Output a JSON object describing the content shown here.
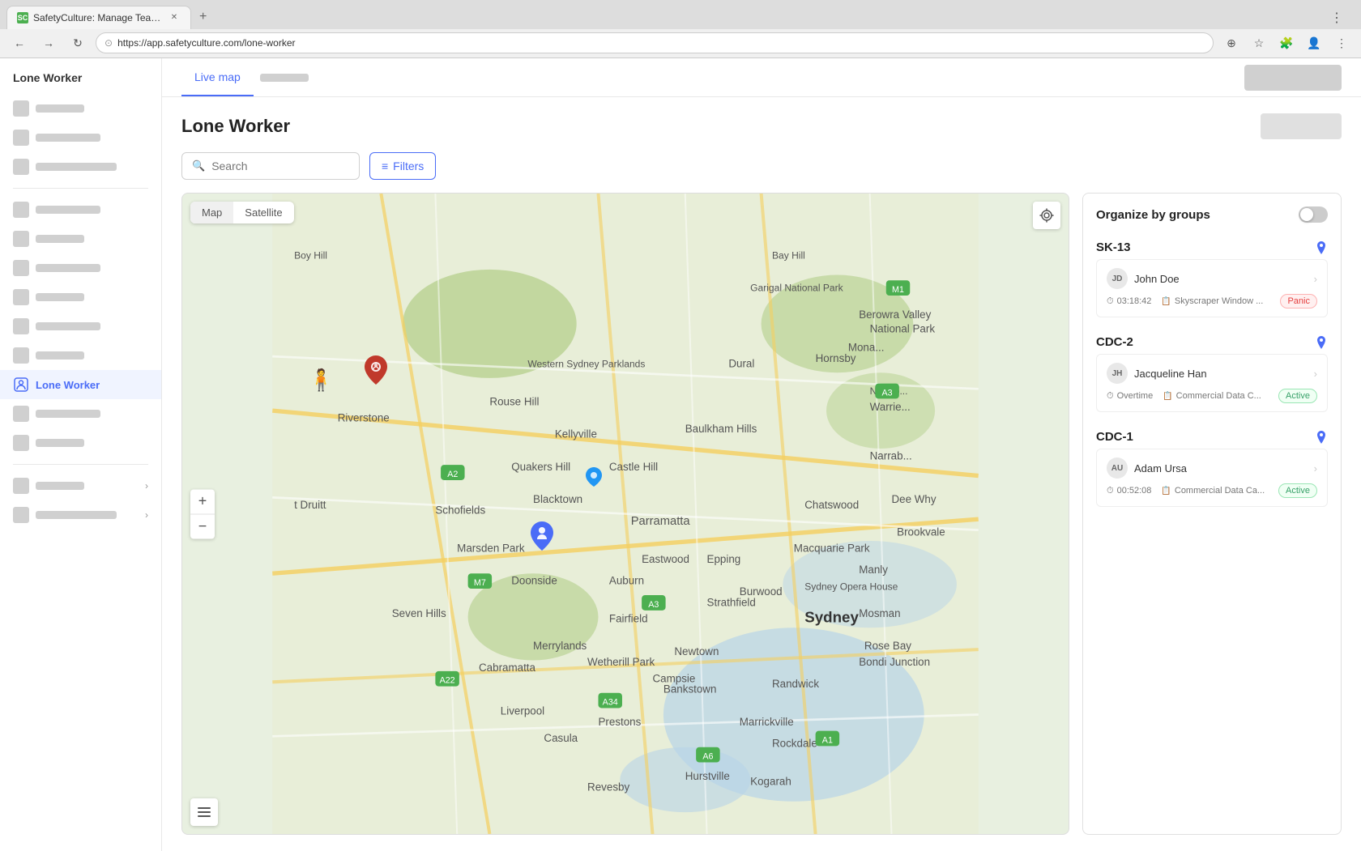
{
  "browser": {
    "tab_title": "SafetyCulture: Manage Teams and...",
    "url": "https://app.safetyculture.com/lone-worker",
    "favicon_text": "SC"
  },
  "nav": {
    "live_map_tab": "Live map",
    "second_tab_placeholder": "",
    "export_btn": ""
  },
  "page": {
    "title": "Lone Worker",
    "search_placeholder": "Search",
    "filter_btn": "Filters"
  },
  "map": {
    "tab_map": "Map",
    "tab_satellite": "Satellite"
  },
  "sidebar": {
    "title": "Lone Worker",
    "lone_worker_label": "Lone Worker"
  },
  "panel": {
    "title": "Organize by groups",
    "groups": [
      {
        "id": "SK-13",
        "name": "SK-13",
        "worker_name": "John Doe",
        "worker_initials": "JD",
        "time": "03:18:42",
        "location": "Skyscraper Window ...",
        "status": "Panic",
        "status_type": "panic",
        "overtime": false
      },
      {
        "id": "CDC-2",
        "name": "CDC-2",
        "worker_name": "Jacqueline Han",
        "worker_initials": "JH",
        "time": "Overtime",
        "location": "Commercial Data C...",
        "status": "Active",
        "status_type": "active",
        "overtime": true
      },
      {
        "id": "CDC-1",
        "name": "CDC-1",
        "worker_name": "Adam Ursa",
        "worker_initials": "AU",
        "time": "00:52:08",
        "location": "Commercial Data Ca...",
        "status": "Active",
        "status_type": "active",
        "overtime": false
      }
    ]
  }
}
